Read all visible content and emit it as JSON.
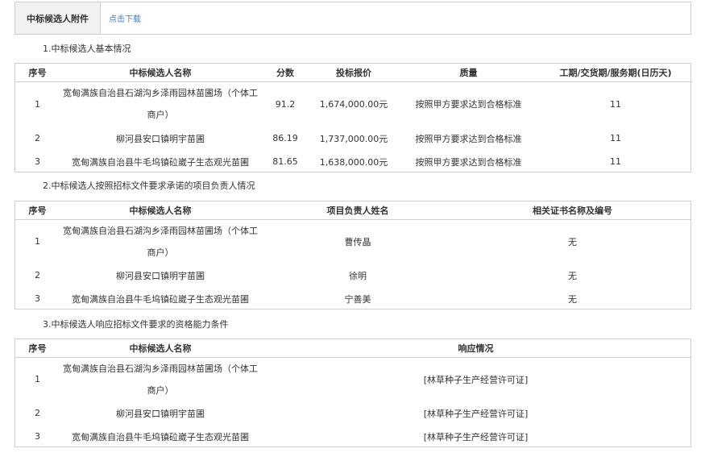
{
  "attachment": {
    "label": "中标候选人附件",
    "link_text": "点击下载"
  },
  "section1": {
    "title": "1.中标候选人基本情况",
    "headers": [
      "序号",
      "中标候选人名称",
      "分数",
      "投标报价",
      "质量",
      "工期/交货期/服务期(日历天)"
    ],
    "rows": [
      [
        "1",
        "宽甸满族自治县石湖沟乡泽雨园林苗圃场（个体工商户）",
        "91.2",
        "1,674,000.00元",
        "按照甲方要求达到合格标准",
        "11"
      ],
      [
        "2",
        "柳河县安口镇明宇苗圃",
        "86.19",
        "1,737,000.00元",
        "按照甲方要求达到合格标准",
        "11"
      ],
      [
        "3",
        "宽甸满族自治县牛毛坞镇砬崴子生态观光苗圃",
        "81.65",
        "1,638,000.00元",
        "按照甲方要求达到合格标准",
        "11"
      ]
    ]
  },
  "section2": {
    "title": "2.中标候选人按照招标文件要求承诺的项目负责人情况",
    "headers": [
      "序号",
      "中标候选人名称",
      "项目负责人姓名",
      "相关证书名称及编号"
    ],
    "rows": [
      [
        "1",
        "宽甸满族自治县石湖沟乡泽雨园林苗圃场（个体工商户）",
        "曹传晶",
        "无"
      ],
      [
        "2",
        "柳河县安口镇明宇苗圃",
        "徐明",
        "无"
      ],
      [
        "3",
        "宽甸满族自治县牛毛坞镇砬崴子生态观光苗圃",
        "宁善美",
        "无"
      ]
    ]
  },
  "section3": {
    "title": "3.中标候选人响应招标文件要求的资格能力条件",
    "headers": [
      "序号",
      "中标候选人名称",
      "响应情况"
    ],
    "rows": [
      [
        "1",
        "宽甸满族自治县石湖沟乡泽雨园林苗圃场（个体工商户）",
        "[林草种子生产经营许可证]"
      ],
      [
        "2",
        "柳河县安口镇明宇苗圃",
        "[林草种子生产经营许可证]"
      ],
      [
        "3",
        "宽甸满族自治县牛毛坞镇砬崴子生态观光苗圃",
        "[林草种子生产经营许可证]"
      ]
    ]
  }
}
